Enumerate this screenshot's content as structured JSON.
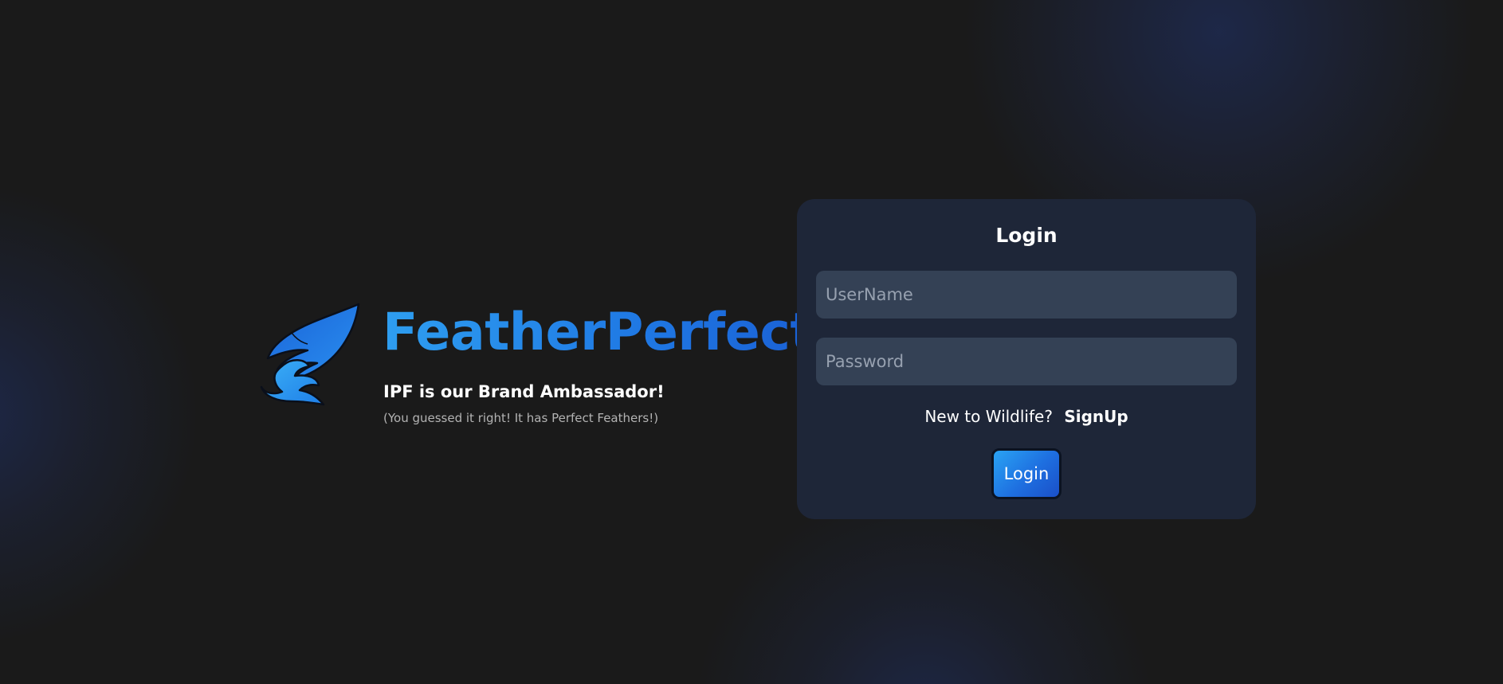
{
  "brand": {
    "logo_icon": "phoenix-feather-logo",
    "name": "FeatherPerfect",
    "tagline": "IPF is our Brand Ambassador!",
    "subtagline": "(You guessed it right! It has Perfect Feathers!)"
  },
  "login": {
    "title": "Login",
    "username_placeholder": "UserName",
    "password_placeholder": "Password",
    "signup_prompt": "New to Wildlife?",
    "signup_link": "SignUp",
    "submit_label": "Login"
  },
  "colors": {
    "background": "#1a1a1a",
    "card": "#1e2638",
    "input": "#344155",
    "brand_blue": "#1f78e4",
    "accent_light_blue": "#2aa3f4"
  }
}
